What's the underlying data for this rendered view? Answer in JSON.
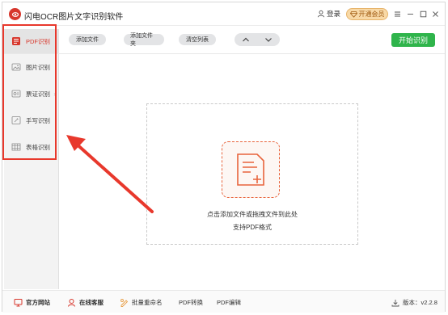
{
  "app": {
    "title": "闪电OCR图片文字识别软件",
    "login_label": "登录",
    "vip_label": "开通会员"
  },
  "toolbar": {
    "add_file": "添加文件",
    "add_folder": "添加文件夹",
    "clear_list": "清空列表",
    "start": "开始识别"
  },
  "sidebar": {
    "items": [
      {
        "label": "PDF识别",
        "icon": "pdf-icon",
        "active": true
      },
      {
        "label": "图片识别",
        "icon": "image-icon",
        "active": false
      },
      {
        "label": "票证识别",
        "icon": "ticket-icon",
        "active": false
      },
      {
        "label": "手写识别",
        "icon": "handwriting-icon",
        "active": false
      },
      {
        "label": "表格识别",
        "icon": "table-icon",
        "active": false
      }
    ]
  },
  "drop": {
    "line1": "点击添加文件或拖拽文件到此处",
    "line2": "支持PDF格式"
  },
  "footer": {
    "website": "官方网站",
    "support": "在线客服",
    "batch_rename": "批量重命名",
    "pdf_convert": "PDF转换",
    "pdf_edit": "PDF编辑",
    "version": "版本：v2.2.8"
  },
  "colors": {
    "accent_red": "#d7372c",
    "start_green": "#2fb44b",
    "annotation_red": "#e8382c"
  }
}
